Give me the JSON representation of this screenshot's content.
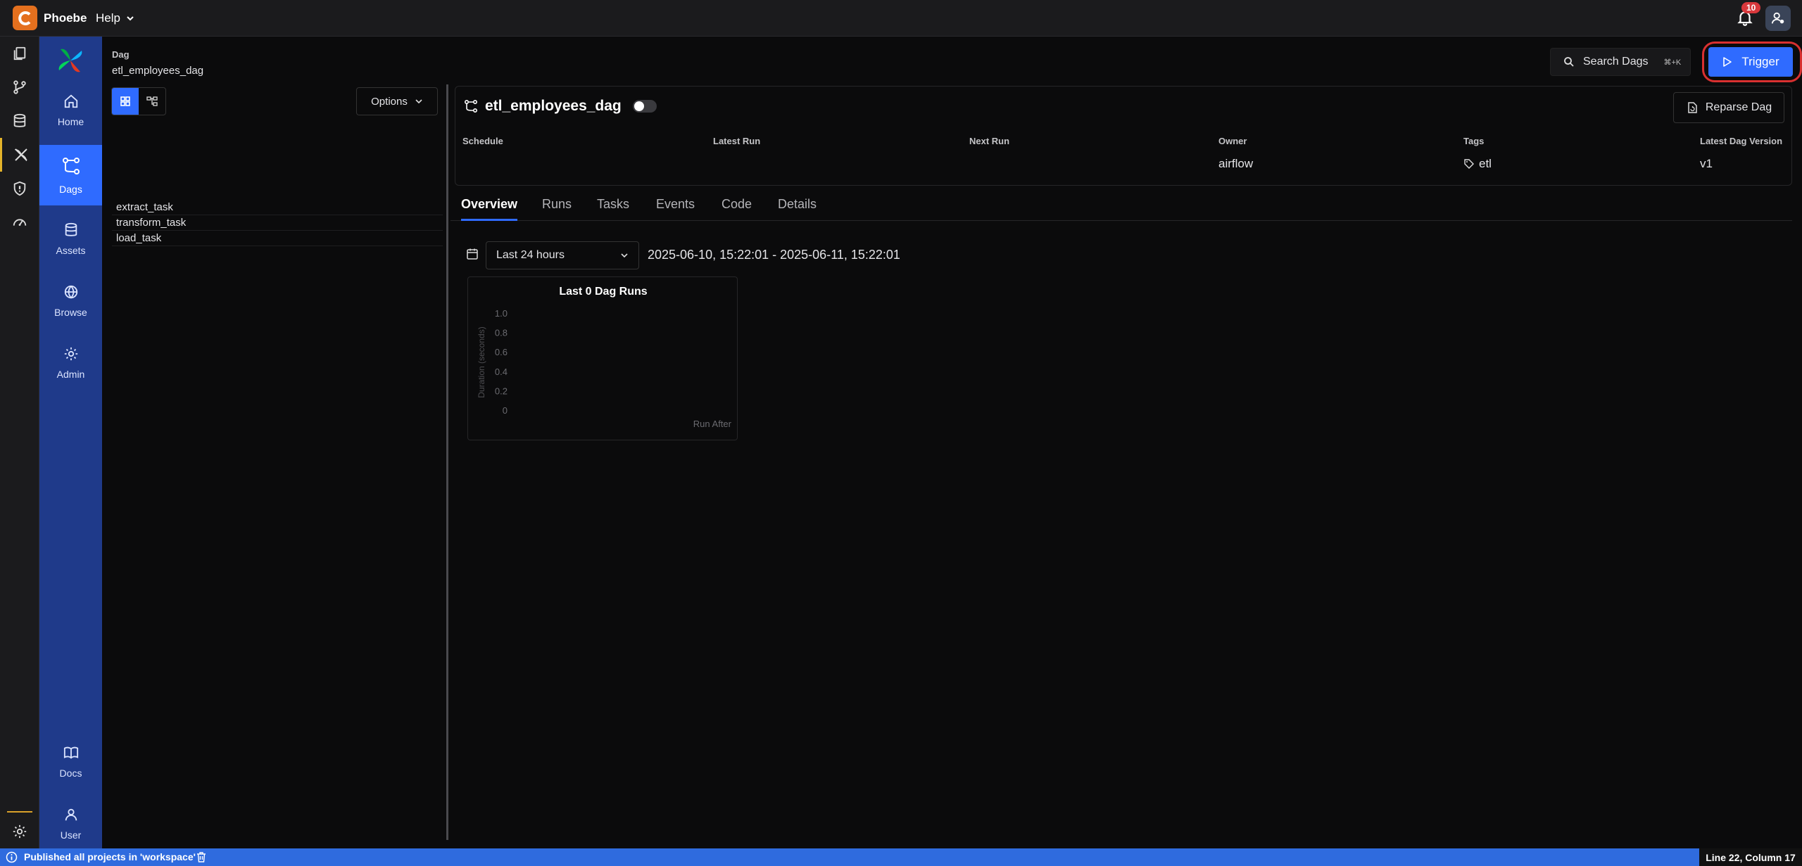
{
  "app": {
    "name": "Phoebe",
    "help_label": "Help",
    "notification_count": "10"
  },
  "activity_bar": {
    "items": [
      "files-icon",
      "source-control-icon",
      "database-icon",
      "airflow-icon",
      "shield-icon",
      "gauge-icon",
      "gear-icon"
    ],
    "active": "airflow-icon"
  },
  "nav": {
    "items": [
      {
        "label": "Home",
        "icon": "home-icon"
      },
      {
        "label": "Dags",
        "icon": "dags-icon"
      },
      {
        "label": "Assets",
        "icon": "assets-icon"
      },
      {
        "label": "Browse",
        "icon": "globe-icon"
      },
      {
        "label": "Admin",
        "icon": "gear-icon"
      },
      {
        "label": "Docs",
        "icon": "book-icon"
      },
      {
        "label": "User",
        "icon": "user-icon"
      }
    ],
    "active": "Dags"
  },
  "breadcrumb": {
    "label": "Dag",
    "value": "etl_employees_dag"
  },
  "tree": {
    "options_label": "Options",
    "tasks": [
      "extract_task",
      "transform_task",
      "load_task"
    ]
  },
  "header": {
    "search_label": "Search Dags",
    "search_shortcut": "⌘+K",
    "trigger_label": "Trigger"
  },
  "dag": {
    "title": "etl_employees_dag",
    "reparse_label": "Reparse Dag",
    "meta": [
      {
        "label": "Schedule",
        "value": ""
      },
      {
        "label": "Latest Run",
        "value": ""
      },
      {
        "label": "Next Run",
        "value": ""
      },
      {
        "label": "Owner",
        "value": "airflow"
      },
      {
        "label": "Tags",
        "value": "etl"
      },
      {
        "label": "Latest Dag Version",
        "value": "v1"
      }
    ]
  },
  "tabs": [
    "Overview",
    "Runs",
    "Tasks",
    "Events",
    "Code",
    "Details"
  ],
  "active_tab": "Overview",
  "overview": {
    "range_option": "Last 24 hours",
    "range_text": "2025-06-10, 15:22:01 - 2025-06-11, 15:22:01"
  },
  "chart_data": {
    "type": "bar",
    "title": "Last 0 Dag Runs",
    "xlabel": "Run After",
    "ylabel": "Duration (seconds)",
    "categories": [],
    "values": [],
    "ylim": [
      0,
      1.0
    ],
    "yticks": [
      "1.0",
      "0.8",
      "0.6",
      "0.4",
      "0.2",
      "0"
    ]
  },
  "statusbar": {
    "message": "Published all projects in 'workspace'",
    "position": "Line 22, Column 17"
  },
  "colors": {
    "accent": "#2f6bff",
    "nav_bg": "#1f3a8a",
    "status_bg": "#2f6bde",
    "brand": "#e4701e",
    "highlight": "#d93030"
  }
}
